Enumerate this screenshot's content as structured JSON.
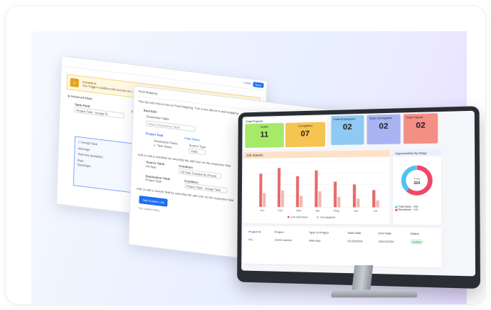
{
  "back_window": {
    "link_label": "Local",
    "save_label": "Save",
    "condition_title": "Condition",
    "condition_text": "The Trigger condition will execute ALL actions on a direct if it result it meets the set condition criteria.",
    "advanced_mode": "Advanced Mode",
    "table_field_label": "Table Field",
    "table_field_value": "Project Task - Assign To",
    "operator_label": "Ope",
    "task_title": "Assign Task",
    "message_label": "Message",
    "task_assigned_label": "Task has assigned...",
    "role_label": "Role",
    "role_value": "Developer"
  },
  "mid_window": {
    "title": "Field Mapping",
    "subtitle": "This Second Action has no Field Mapping. Tick a row above to add mapping.",
    "rule_label": "Rule Edit",
    "destination_table_label": "Destination Table",
    "destination_table_placeholder": "Select Destination Table",
    "tab_project": "Project Task",
    "tab_field": "Field Name",
    "destination_fields_label": "Destination Fields",
    "task_name_item": "1. Task Name",
    "source_type_label": "Source Type",
    "source_type_value": "Field",
    "helper_text": "Add or edit a condition by selecting the add icon on the respective field",
    "source_table_label": "Source Table",
    "source_table_value": "All Task",
    "condition_label": "Condition",
    "condition_value": "All Task Created by (Fixed)",
    "destination_table2_label": "Destination Table",
    "destination_table2_value": "Project Task",
    "condition2_label": "Condition",
    "condition2_value": "Project Task - Assign Task",
    "footer_text": "Add or edit a custom field by selecting the add icon on the respective field",
    "add_button": "Add Custom Link",
    "linked_text": "No custom links"
  },
  "dashboard": {
    "kpis": [
      {
        "label": "Total Projects",
        "sub": "Active",
        "value": "11",
        "color": "#a6ea6a"
      },
      {
        "label": "",
        "sub": "Completed",
        "value": "07",
        "color": "#f6c451"
      },
      {
        "label": "Total Employees",
        "sub": "",
        "value": "02",
        "color": "#8fc9f4"
      },
      {
        "label": "Total Job Applied",
        "sub": "",
        "value": "02",
        "color": "#a8b4f2"
      },
      {
        "label": "Total Payout",
        "sub": "",
        "value": "02",
        "color": "#f48f86"
      }
    ],
    "chart_panel_title": "Job Statistic",
    "donut_panel_title": "Opportunities By Stage",
    "donut_center_label": "Total",
    "donut_center_value": "324",
    "donut_legend": [
      "Total leads : 203",
      "Remainder : 121"
    ],
    "table": {
      "headers": [
        "Project ID",
        "Project",
        "Type of Project",
        "Start Date",
        "End Date",
        "Status"
      ],
      "rows": [
        [
          "PI1",
          "ZOHO Admin",
          "Web App",
          "01/15/2024",
          "05/13/2024",
          "Active"
        ]
      ]
    }
  },
  "chart_data": {
    "type": "bar",
    "categories": [
      "Jan",
      "Feb",
      "Mar",
      "Apr",
      "May",
      "Jun",
      "Jul"
    ],
    "series": [
      {
        "name": "Job Interview",
        "values": [
          60,
          70,
          55,
          65,
          45,
          40,
          30
        ],
        "color": "#e56b6b"
      },
      {
        "name": "Job Applied",
        "values": [
          25,
          30,
          20,
          28,
          18,
          15,
          12
        ],
        "color": "#f3b6b0"
      }
    ],
    "legend_position": "bottom",
    "ylim": [
      0,
      80
    ]
  }
}
